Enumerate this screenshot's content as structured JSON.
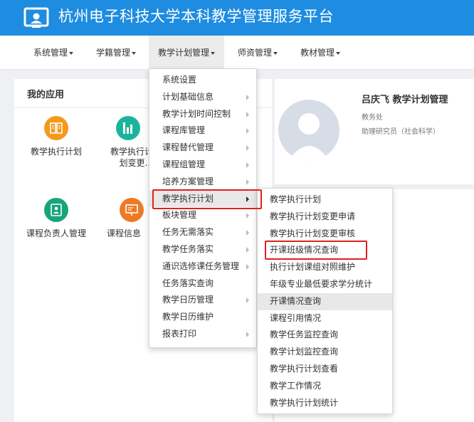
{
  "header": {
    "title": "杭州电子科技大学本科教学管理服务平台"
  },
  "nav": {
    "items": [
      {
        "label": "系统管理"
      },
      {
        "label": "学籍管理"
      },
      {
        "label": "教学计划管理"
      },
      {
        "label": "师资管理"
      },
      {
        "label": "教材管理"
      }
    ]
  },
  "apps": {
    "title": "我的应用",
    "items": [
      {
        "label": "教学执行计划",
        "icon": "book-icon"
      },
      {
        "label": "教学执行计划变更...",
        "icon": "bar-chart-icon"
      },
      {
        "label": "课程负责人管理",
        "icon": "contact-card-icon"
      },
      {
        "label": "课程信息",
        "icon": "presentation-icon"
      }
    ]
  },
  "user": {
    "name": "吕庆飞  教学计划管理",
    "dept": "教务处",
    "title": "助理研究员（社会科学）"
  },
  "menu_primary": [
    {
      "label": "系统设置",
      "arrow": false
    },
    {
      "label": "计划基础信息",
      "arrow": true
    },
    {
      "label": "教学计划时间控制",
      "arrow": true
    },
    {
      "label": "课程库管理",
      "arrow": true
    },
    {
      "label": "课程替代管理",
      "arrow": true
    },
    {
      "label": "课程组管理",
      "arrow": true
    },
    {
      "label": "培养方案管理",
      "arrow": true
    },
    {
      "label": "教学执行计划",
      "arrow": true
    },
    {
      "label": "板块管理",
      "arrow": true
    },
    {
      "label": "任务无需落实",
      "arrow": true
    },
    {
      "label": "教学任务落实",
      "arrow": true
    },
    {
      "label": "通识选修课任务管理",
      "arrow": true
    },
    {
      "label": "任务落实查询",
      "arrow": false
    },
    {
      "label": "教学日历管理",
      "arrow": true
    },
    {
      "label": "教学日历维护",
      "arrow": false
    },
    {
      "label": "报表打印",
      "arrow": true
    }
  ],
  "menu_secondary": [
    {
      "label": "教学执行计划"
    },
    {
      "label": "教学执行计划变更申请"
    },
    {
      "label": "教学执行计划变更审核"
    },
    {
      "label": "开课班级情况查询"
    },
    {
      "label": "执行计划课组对照维护"
    },
    {
      "label": "年级专业最低要求学分统计"
    },
    {
      "label": "开课情况查询"
    },
    {
      "label": "课程引用情况"
    },
    {
      "label": "教学任务监控查询"
    },
    {
      "label": "教学计划监控查询"
    },
    {
      "label": "教学执行计划查看"
    },
    {
      "label": "教学工作情况"
    },
    {
      "label": "教学执行计划统计"
    }
  ],
  "colors": {
    "header_bg": "#1e8ce0",
    "highlight": "#e02020",
    "app_orange": "#f39a1d",
    "app_teal": "#1bb49b",
    "app_green": "#18a57c",
    "app_orange_red": "#ee7a26"
  }
}
